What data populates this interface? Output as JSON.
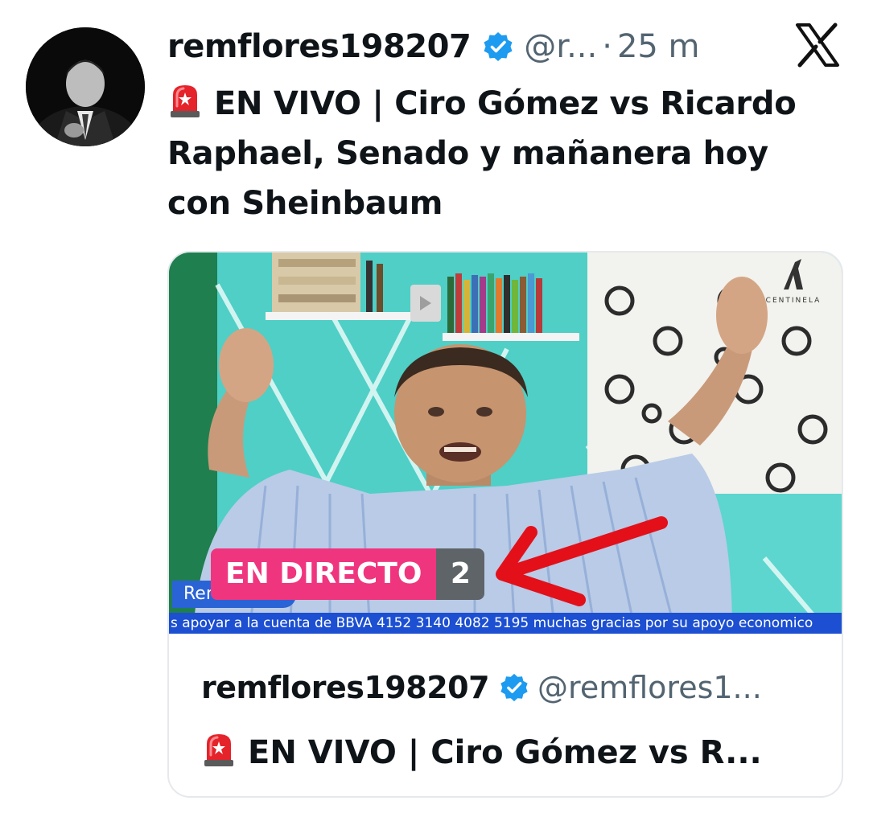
{
  "tweet": {
    "username": "remflores198207",
    "handle": "@r...",
    "separator": "·",
    "time": "25 m",
    "text": "EN VIVO | Ciro Gómez vs Ricardo Raphael, Senado y mañanera hoy con Sheinbaum",
    "leading_icon": "siren-icon"
  },
  "brand": {
    "icon": "x-logo-icon"
  },
  "card": {
    "video": {
      "live_label": "EN DIRECTO",
      "viewer_count": "2",
      "name_tag": "Ren",
      "ticker": "s apoyar a la cuenta de BBVA 4152 3140 4082 5195 muchas gracias por su apoyo economico",
      "channel_logo_text": "CENTINELA"
    },
    "username": "remflores198207",
    "handle": "@remflores1...",
    "title": "EN VIVO | Ciro Gómez vs R..."
  },
  "colors": {
    "verified": "#1d9bf0",
    "live_pink": "#f0357f",
    "arrow_red": "#e3101a",
    "ticker_blue": "#1c4fd1",
    "secondary_text": "#536471"
  }
}
